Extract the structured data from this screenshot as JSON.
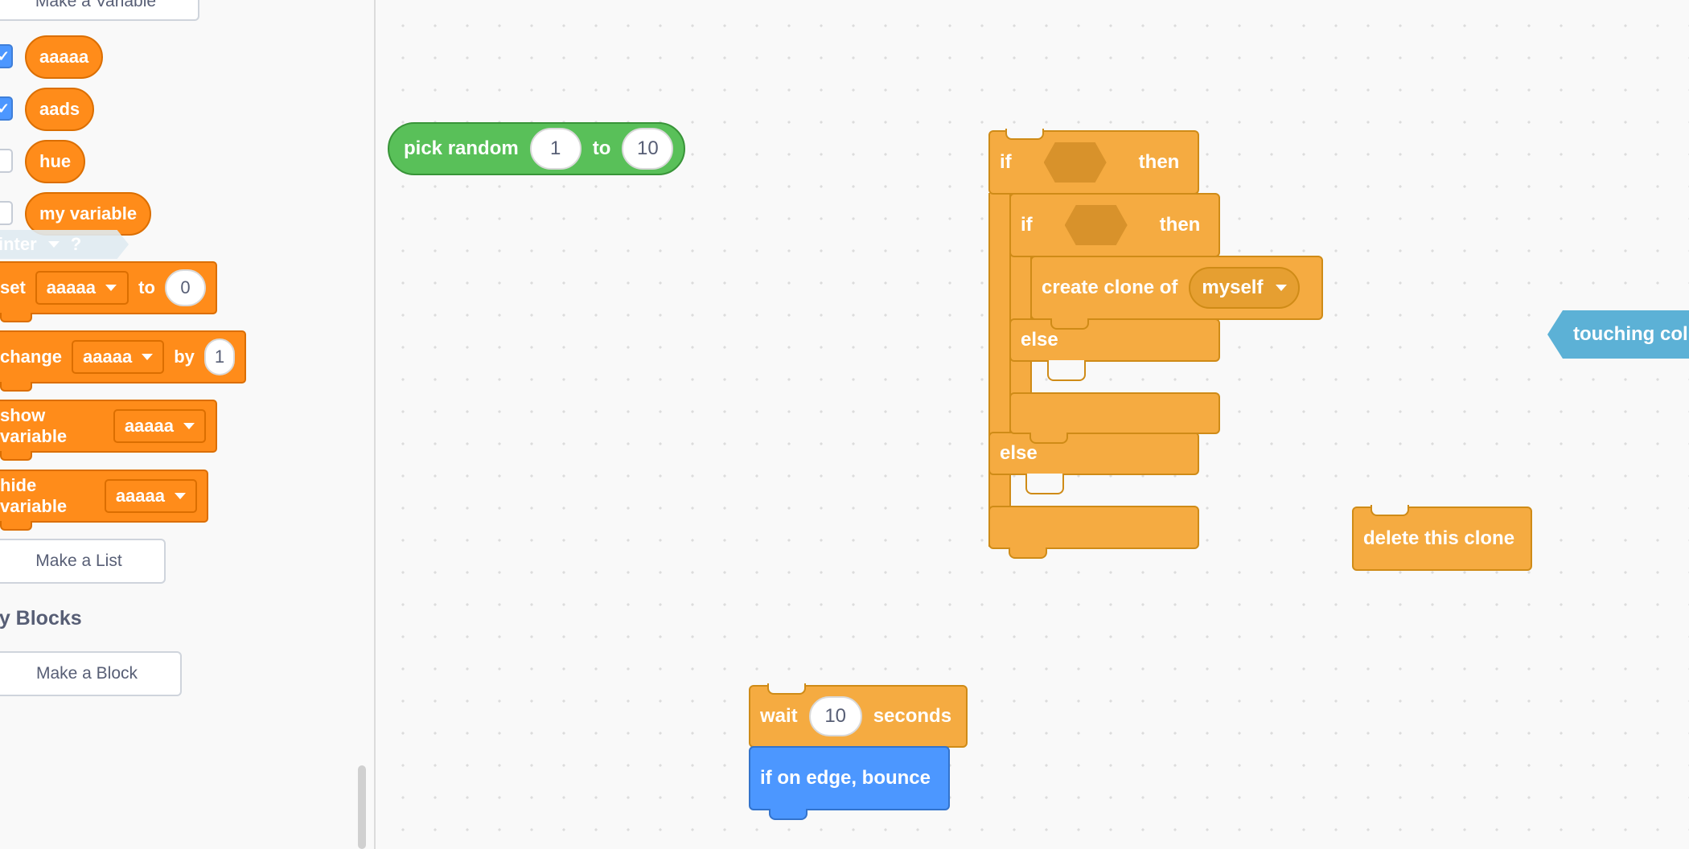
{
  "palette": {
    "make_variable_button": "Make a Variable",
    "variables": [
      {
        "name": "aaaaa",
        "checked": true
      },
      {
        "name": "aads",
        "checked": true
      },
      {
        "name": "hue",
        "checked": false
      },
      {
        "name": "my variable",
        "checked": false
      }
    ],
    "ghost_reporter": {
      "label": "inter",
      "help": "?"
    },
    "set_block": {
      "label": "set",
      "variable": "aaaaa",
      "to_label": "to",
      "value": "0"
    },
    "change_block": {
      "label": "change",
      "variable": "aaaaa",
      "by_label": "by",
      "value": "1"
    },
    "show_variable_block": {
      "label": "show variable",
      "variable": "aaaaa"
    },
    "hide_variable_block": {
      "label": "hide variable",
      "variable": "aaaaa"
    },
    "make_list_button": "Make a List",
    "my_blocks_heading": "My Blocks",
    "make_block_button": "Make a Block"
  },
  "workspace": {
    "pick_random": {
      "label": "pick random",
      "from": "1",
      "to_label": "to",
      "to": "10"
    },
    "outer_if": {
      "if_label": "if",
      "then_label": "then",
      "else_label": "else"
    },
    "inner_if": {
      "if_label": "if",
      "then_label": "then",
      "else_label": "else"
    },
    "create_clone": {
      "label": "create clone of",
      "target": "myself"
    },
    "touching_color": {
      "label": "touching col"
    },
    "delete_clone": {
      "label": "delete this clone"
    },
    "wait_block": {
      "label": "wait",
      "value": "10",
      "unit": "seconds"
    },
    "bounce_block": {
      "label": "if on edge, bounce"
    }
  },
  "colors": {
    "variables": "#ff8c1a",
    "control": "#ffab19",
    "operators": "#59c059",
    "motion": "#4c97ff",
    "sensing": "#5cb1d6"
  }
}
